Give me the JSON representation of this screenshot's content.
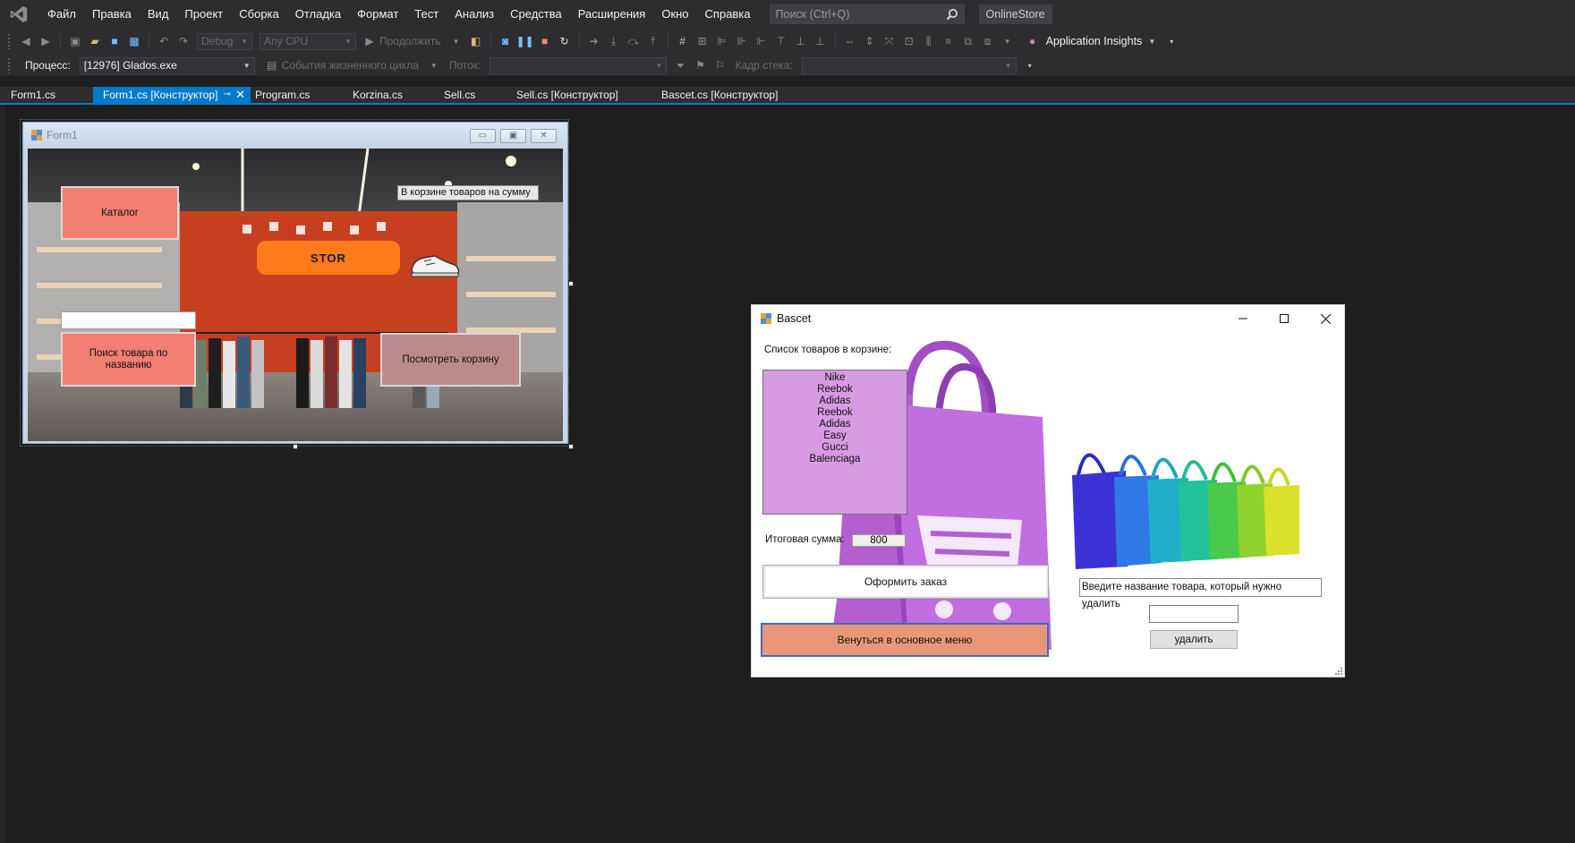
{
  "menu": {
    "items": [
      "Файл",
      "Правка",
      "Вид",
      "Проект",
      "Сборка",
      "Отладка",
      "Формат",
      "Тест",
      "Анализ",
      "Средства",
      "Расширения",
      "Окно",
      "Справка"
    ],
    "search_placeholder": "Поиск (Ctrl+Q)",
    "solution_name": "OnlineStore"
  },
  "toolbar": {
    "configuration": "Debug",
    "platform": "Any CPU",
    "continue_label": "Продолжить",
    "app_insights_label": "Application Insights"
  },
  "debug_toolbar": {
    "process_label": "Процесс:",
    "process_value": "[12976] Glados.exe",
    "lifecycle_label": "События жизненного цикла",
    "thread_label": "Поток:",
    "stack_frame_label": "Кадр стека:"
  },
  "tabs": [
    {
      "label": "Form1.cs",
      "active": false
    },
    {
      "label": "Form1.cs [Конструктор]",
      "active": true
    },
    {
      "label": "Program.cs",
      "active": false
    },
    {
      "label": "Korzina.cs",
      "active": false
    },
    {
      "label": "Sell.cs",
      "active": false
    },
    {
      "label": "Sell.cs [Конструктор]",
      "active": false
    },
    {
      "label": "Bascet.cs [Конструктор]",
      "active": false
    }
  ],
  "form1": {
    "title": "Form1",
    "catalog_button": "Каталог",
    "cart_sum_label": "В корзине товаров на сумму",
    "store_badge": "STOR",
    "search_textbox_value": "",
    "search_button": "Поиск товара по названию",
    "view_cart_button": "Посмотреть корзину"
  },
  "bascet": {
    "title": "Bascet",
    "list_label": "Список товаров в корзине:",
    "items": [
      "Nike",
      "Reebok",
      "Adidas",
      "Reebok",
      "Adidas",
      "Easy",
      "Gucci",
      "Balenciaga"
    ],
    "total_label": "Итоговая сумма:",
    "total_value": "800",
    "checkout_button": "Оформить заказ",
    "back_button": "Венуться в основное меню",
    "delete_prompt": "Введите название товара, который нужно удалить",
    "delete_input_value": "",
    "delete_button": "удалить"
  },
  "colors": {
    "ide_background": "#1e1e1e",
    "ide_chrome": "#2d2d30",
    "accent": "#007acc",
    "salmon_button": "#f27f72",
    "mauve_button": "#b98b8c",
    "list_purple": "#d79be1",
    "back_button_orange": "#e9967a",
    "store_badge_orange": "#ff7a1a"
  }
}
